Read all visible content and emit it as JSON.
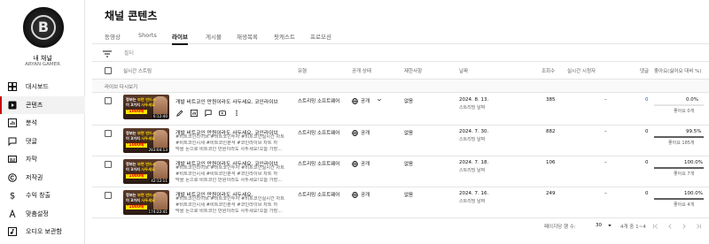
{
  "sidebar": {
    "avatar_letter": "B",
    "channel_label": "내 채널",
    "channel_name": "ARYAN GAMER",
    "items": [
      {
        "label": "대시보드",
        "icon": "dashboard-icon"
      },
      {
        "label": "콘텐츠",
        "icon": "content-icon",
        "active": true
      },
      {
        "label": "분석",
        "icon": "analytics-icon"
      },
      {
        "label": "댓글",
        "icon": "comments-icon"
      },
      {
        "label": "자막",
        "icon": "subtitles-icon"
      },
      {
        "label": "저작권",
        "icon": "copyright-icon"
      },
      {
        "label": "수익 창출",
        "icon": "monetization-icon"
      },
      {
        "label": "맞춤설정",
        "icon": "customization-icon"
      },
      {
        "label": "오디오 보관함",
        "icon": "audio-library-icon"
      }
    ]
  },
  "main": {
    "title": "채널 콘텐츠",
    "tabs": [
      "동영상",
      "Shorts",
      "라이브",
      "게시물",
      "재생목록",
      "팟캐스트",
      "프로모션"
    ],
    "active_tab": "라이브",
    "filter_label": "필터",
    "columns": {
      "stream": "실시간 스트림",
      "type": "유형",
      "visibility": "공개 상태",
      "restrictions": "제한사항",
      "date": "날짜",
      "views": "조회수",
      "concurrent": "실시간 시청자",
      "comments": "댓글",
      "likes": "좋아요(싫어요 대비 %)"
    },
    "section_label": "라이브 다시보기"
  },
  "rows": [
    {
      "thumb_l1": "정보는",
      "thumb_l1_hl": "보면 반드시",
      "thumb_l2": "이 3가지",
      "thumb_l2_hl": "사두세요",
      "thumb_tag": "\"1000배\"",
      "duration": "6:12:40",
      "title": "개발 비트코인 만원이라도 사두세요. 코인라이브",
      "desc_lines": [],
      "type": "스트리밍 소프트웨어",
      "visibility": "공개",
      "restriction": "없음",
      "date": "2024. 8. 13.",
      "date_sub": "스트리밍 날짜",
      "views": "385",
      "concurrent": "–",
      "comments": "0",
      "likes_pct": "0.0%",
      "likes_sub": "좋아요 0개",
      "likes_fraction": 0.0,
      "show_actions": true
    },
    {
      "thumb_l1": "정보는",
      "thumb_l1_hl": "보면 반드시",
      "thumb_l2": "이 3가지",
      "thumb_l2_hl": "사두세요",
      "thumb_tag": "\"1000배\"",
      "duration": "283:04:13",
      "title": "개발 비트코인 만원이라도 사두세요. 코인라이브",
      "desc_lines": [
        "#비트코인라이브 #비트코인투자 #비트코인실시간 차트",
        "#비트코인시세 #비트코인분석 #코인라이브 차트 자",
        "막을 돈으로 비트코인 만원이라도 사두세요!오늘 가장..."
      ],
      "type": "스트리밍 소프트웨어",
      "visibility": "공개",
      "restriction": "없음",
      "date": "2024. 7. 30.",
      "date_sub": "스트리밍 날짜",
      "views": "882",
      "concurrent": "–",
      "comments": "0",
      "likes_pct": "99.5%",
      "likes_sub": "좋아요 185개",
      "likes_fraction": 0.995,
      "show_actions": false
    },
    {
      "thumb_l1": "정보는",
      "thumb_l1_hl": "보면 반드시",
      "thumb_l2": "이 3가지",
      "thumb_l2_hl": "사두세요",
      "thumb_tag": "\"1000배\"",
      "duration": "42:12:11",
      "title": "개발 비트코인 만원이라도 사두세요. 코인라이브",
      "desc_lines": [
        "#비트코인라이브 #비트코인투자 #비트코인실시간 차트",
        "#비트코인시세 #비트코인분석 #코인라이브 차트 자",
        "막을 돈으로 비트코인 만원이라도 사두세요!오늘 가장..."
      ],
      "type": "스트리밍 소프트웨어",
      "visibility": "공개",
      "restriction": "없음",
      "date": "2024. 7. 18.",
      "date_sub": "스트리밍 날짜",
      "views": "106",
      "concurrent": "–",
      "comments": "0",
      "likes_pct": "100.0%",
      "likes_sub": "좋아요 7개",
      "likes_fraction": 1.0,
      "show_actions": false
    },
    {
      "thumb_l1": "정보는",
      "thumb_l1_hl": "보면 반드시",
      "thumb_l2": "이 3가지",
      "thumb_l2_hl": "사두세요",
      "thumb_tag": "\"1000배\"",
      "duration": "174:22:41",
      "title": "개발 비트코인 만원이라도 사두세요.",
      "desc_lines": [
        "#비트코인라이브 #비트코인투자 #비트코인실시간 차트",
        "#비트코인시세 #비트코인분석 #코인라이브 차트 자",
        "막을 돈으로 비트코인 만원이라도 사두세요!오늘 가장..."
      ],
      "type": "스트리밍 소프트웨어",
      "visibility": "공개",
      "restriction": "없음",
      "date": "2024. 7. 16.",
      "date_sub": "스트리밍 날짜",
      "views": "249",
      "concurrent": "–",
      "comments": "0",
      "likes_pct": "100.0%",
      "likes_sub": "좋아요 4개",
      "likes_fraction": 1.0,
      "show_actions": false
    }
  ],
  "pagination": {
    "rows_label": "페이지당 행 수:",
    "rows_value": "30",
    "range": "4개 중 1~4"
  },
  "colors": {
    "accent": "#cc0000",
    "link": "#065fd4",
    "highlight": "#ffd400",
    "tag_bg": "#ffe600",
    "tag_fg": "#e00000"
  }
}
